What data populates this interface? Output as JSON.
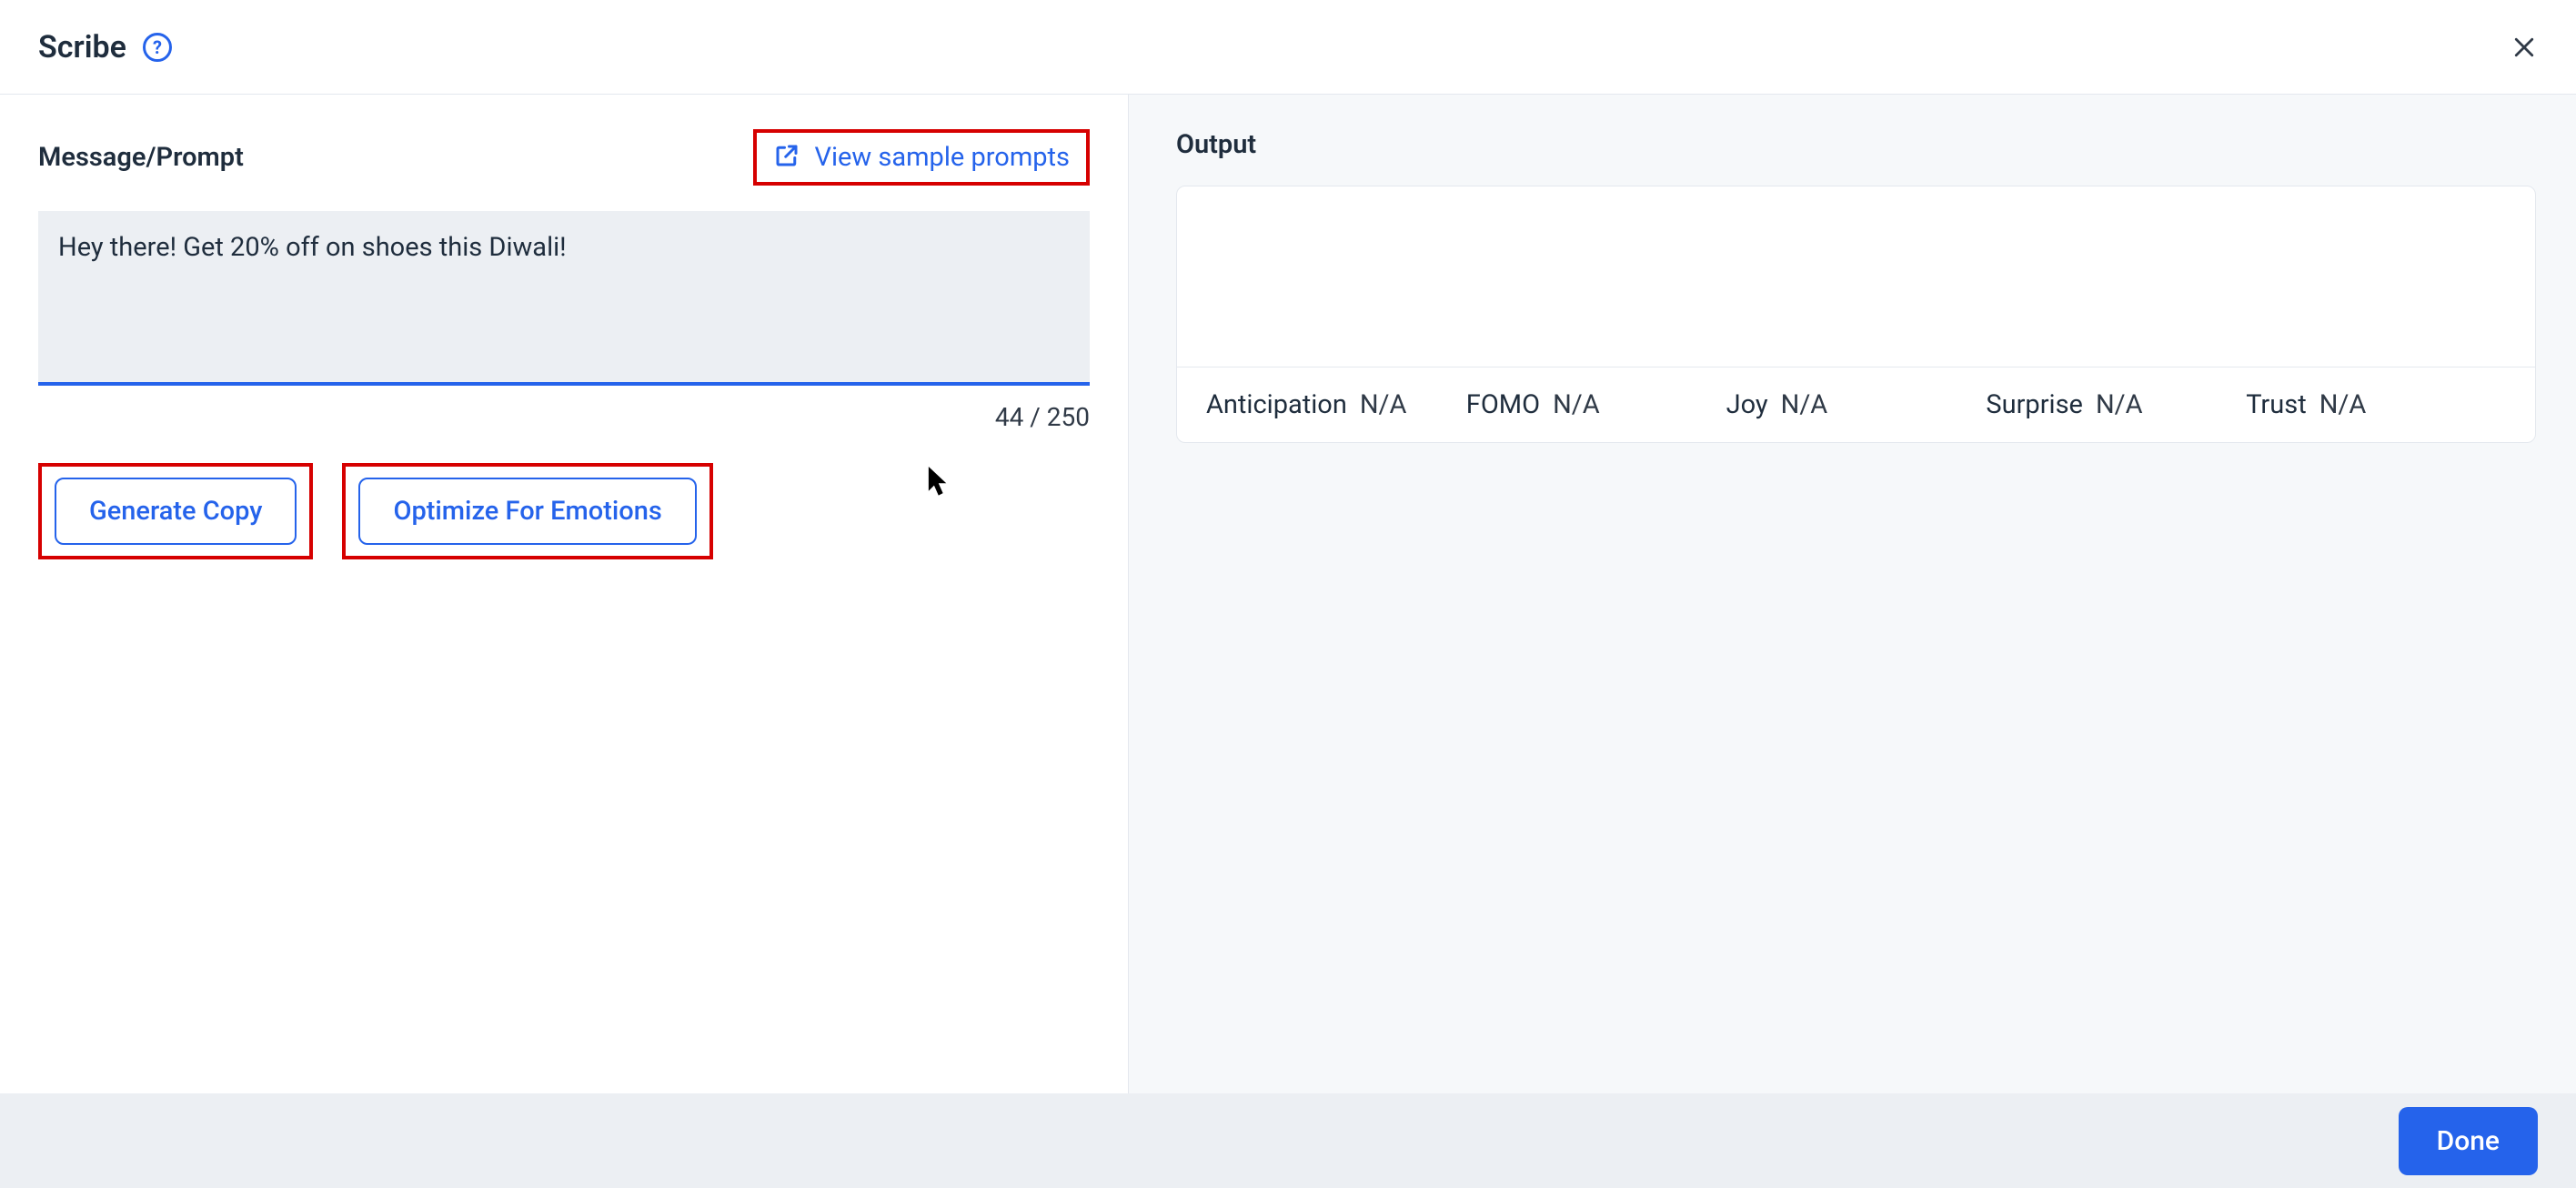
{
  "header": {
    "title": "Scribe"
  },
  "left": {
    "section_label": "Message/Prompt",
    "view_sample_label": "View sample prompts",
    "prompt_value": "Hey there! Get 20% off on shoes this Diwali!",
    "char_counter": "44 / 250",
    "generate_button": "Generate Copy",
    "optimize_button": "Optimize For Emotions"
  },
  "right": {
    "section_label": "Output",
    "emotions": [
      {
        "name": "Anticipation",
        "value": "N/A"
      },
      {
        "name": "FOMO",
        "value": "N/A"
      },
      {
        "name": "Joy",
        "value": "N/A"
      },
      {
        "name": "Surprise",
        "value": "N/A"
      },
      {
        "name": "Trust",
        "value": "N/A"
      }
    ]
  },
  "footer": {
    "done": "Done"
  }
}
